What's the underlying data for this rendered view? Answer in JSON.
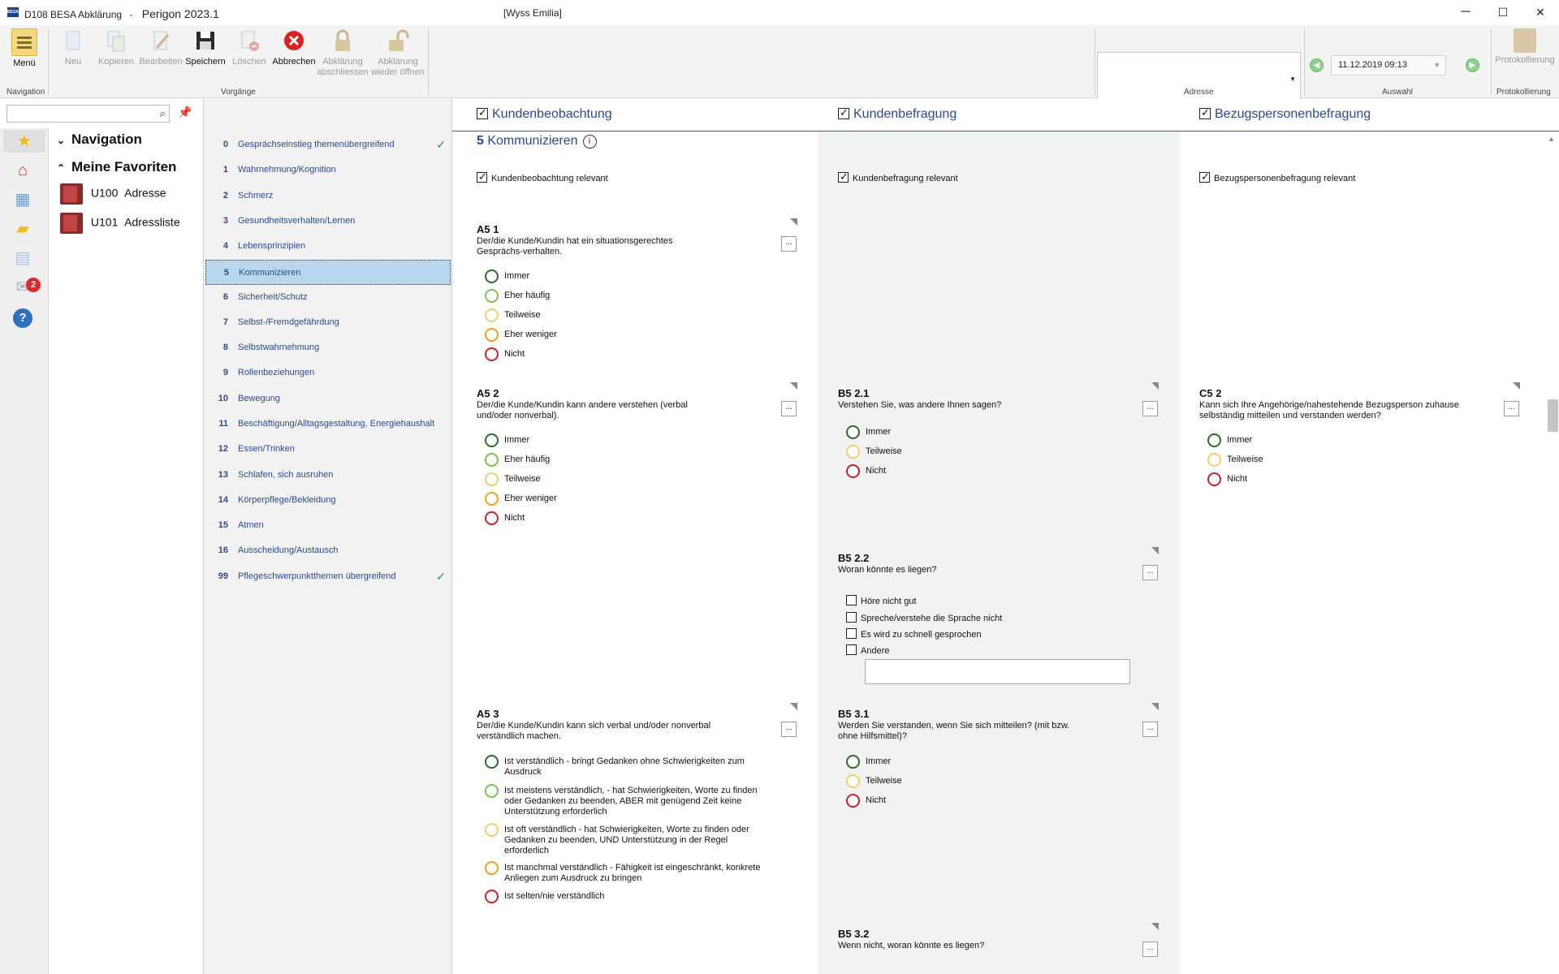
{
  "window": {
    "app_code": "D108 BESA Abklärung",
    "separator": "-",
    "app_name": "Perigon 2023.1",
    "user": "[Wyss Emilia]",
    "icon_text": "BESA",
    "minimize": "─",
    "maximize": "☐",
    "close": "✕"
  },
  "ribbon": {
    "buttons": {
      "menu": "Menü",
      "neu": "Neu",
      "kopieren": "Kopieren",
      "bearbeiten": "Bearbeiten",
      "speichern": "Speichern",
      "loeschen": "Löschen",
      "abbrechen": "Abbrechen",
      "abschliessen_1": "Abklärung",
      "abschliessen_2": "abschliessen",
      "oeffnen_1": "Abklärung",
      "oeffnen_2": "wieder öffnen",
      "protokollierung": "Protokollierung"
    },
    "groups": {
      "navigation": "Navigation",
      "vorgaenge": "Vorgänge",
      "adresse": "Adresse",
      "auswahl": "Auswahl",
      "protokollierung": "Protokollierung"
    },
    "date_value": "11.12.2019 09:13"
  },
  "left_panel": {
    "search_placeholder": "",
    "navigation_header": "Navigation",
    "favorites_header": "Meine Favoriten",
    "favorites": [
      {
        "code": "U100",
        "label": "Adresse"
      },
      {
        "code": "U101",
        "label": "Adressliste"
      }
    ],
    "badge_count": "2"
  },
  "topics": [
    {
      "num": "0",
      "label": "Gesprächseinstieg themenübergreifend",
      "done": true
    },
    {
      "num": "1",
      "label": "Wahrnehmung/Kognition",
      "done": false
    },
    {
      "num": "2",
      "label": "Schmerz",
      "done": false
    },
    {
      "num": "3",
      "label": "Gesundheitsverhalten/Lernen",
      "done": false
    },
    {
      "num": "4",
      "label": "Lebensprinzipien",
      "done": false
    },
    {
      "num": "5",
      "label": "Kommunizieren",
      "done": false,
      "selected": true
    },
    {
      "num": "6",
      "label": "Sicherheit/Schutz",
      "done": false
    },
    {
      "num": "7",
      "label": "Selbst-/Fremdgefährdung",
      "done": false
    },
    {
      "num": "8",
      "label": "Selbstwahrnehmung",
      "done": false
    },
    {
      "num": "9",
      "label": "Rollenbeziehungen",
      "done": false
    },
    {
      "num": "10",
      "label": "Bewegung",
      "done": false
    },
    {
      "num": "11",
      "label": "Beschäftigung/Alltagsgestaltung, Energiehaushalt",
      "done": false
    },
    {
      "num": "12",
      "label": "Essen/Trinken",
      "done": false
    },
    {
      "num": "13",
      "label": "Schlafen, sich ausruhen",
      "done": false
    },
    {
      "num": "14",
      "label": "Körperpflege/Bekleidung",
      "done": false
    },
    {
      "num": "15",
      "label": "Atmen",
      "done": false
    },
    {
      "num": "16",
      "label": "Ausscheidung/Austausch",
      "done": false
    },
    {
      "num": "99",
      "label": "Pflegeschwerpunktthemen übergreifend",
      "done": true
    }
  ],
  "content": {
    "columns": {
      "c1": "Kundenbeobachtung",
      "c2": "Kundenbefragung",
      "c3": "Bezugspersonenbefragung"
    },
    "section_num": "5",
    "section_title": "Kommunizieren",
    "relevant": {
      "c1": "Kundenbeobachtung relevant",
      "c2": "Kundenbefragung relevant",
      "c3": "Bezugspersonenbefragung relevant"
    },
    "more_label": "...",
    "a5_1": {
      "id": "A5 1",
      "text": "Der/die Kunde/Kundin hat ein situationsgerechtes Gesprächs-verhalten.",
      "options": [
        "Immer",
        "Eher häufig",
        "Teilweise",
        "Eher weniger",
        "Nicht"
      ]
    },
    "a5_2": {
      "id": "A5 2",
      "text": "Der/die Kunde/Kundin kann andere verstehen (verbal und/oder nonverbal).",
      "options": [
        "Immer",
        "Eher häufig",
        "Teilweise",
        "Eher weniger",
        "Nicht"
      ]
    },
    "a5_3": {
      "id": "A5 3",
      "text": "Der/die Kunde/Kundin kann sich verbal und/oder nonverbal verständlich machen.",
      "options": [
        "Ist verständlich - bringt Gedanken ohne Schwierigkeiten zum Ausdruck",
        "Ist meistens verständlich, - hat Schwierigkeiten, Worte zu finden oder Gedanken zu beenden, ABER mit genügend Zeit keine Unterstützung erforderlich",
        "Ist oft verständlich - hat Schwierigkeiten, Worte zu finden oder Gedanken zu beenden, UND Unterstützung in der Regel erforderlich",
        "Ist manchmal verständlich - Fähigkeit ist eingeschränkt, konkrete Anliegen zum Ausdruck zu bringen",
        "Ist selten/nie verständlich"
      ]
    },
    "b5_2_1": {
      "id": "B5 2.1",
      "text": "Verstehen Sie, was andere Ihnen sagen?",
      "options": [
        "Immer",
        "Teilweise",
        "Nicht"
      ]
    },
    "b5_2_2": {
      "id": "B5 2.2",
      "text": "Woran könnte es liegen?",
      "options": [
        "Höre nicht gut",
        "Spreche/verstehe die Sprache nicht",
        "Es wird zu schnell gesprochen",
        "Andere"
      ]
    },
    "b5_3_1": {
      "id": "B5 3.1",
      "text": "Werden Sie verstanden, wenn Sie sich mitteilen? (mit bzw. ohne Hilfsmittel)?",
      "options": [
        "Immer",
        "Teilweise",
        "Nicht"
      ]
    },
    "b5_3_2": {
      "id": "B5 3.2",
      "text": "Wenn nicht, woran könnte es liegen?"
    },
    "c5_2": {
      "id": "C5 2",
      "text": "Kann sich Ihre Angehörige/nahestehende Bezugsperson zuhause selbständig mitteilen und verstanden werden?",
      "options": [
        "Immer",
        "Teilweise",
        "Nicht"
      ]
    }
  }
}
